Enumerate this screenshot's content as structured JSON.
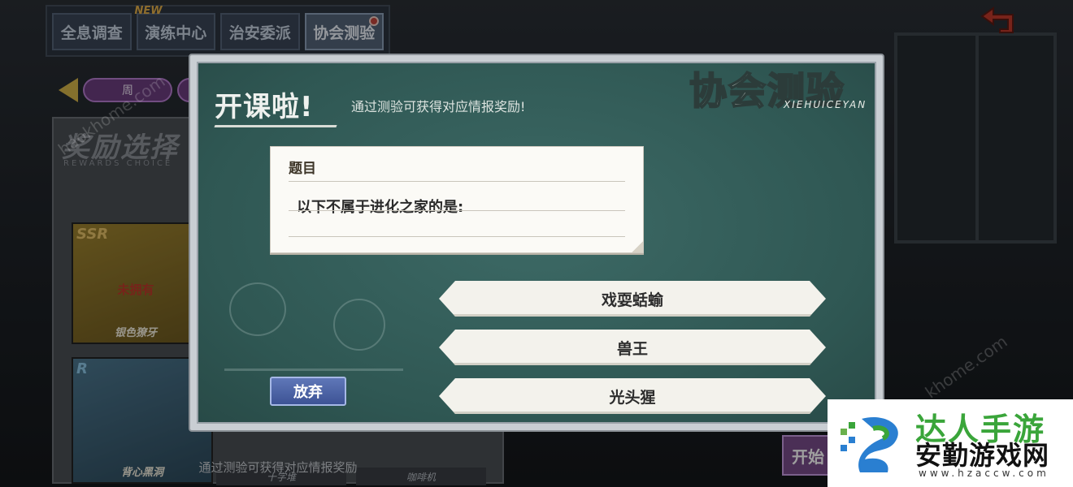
{
  "tabs": [
    {
      "label": "全息调查",
      "active": false
    },
    {
      "label": "演练中心",
      "active": false,
      "badge": "NEW"
    },
    {
      "label": "治安委派",
      "active": false
    },
    {
      "label": "协会测验",
      "active": true
    }
  ],
  "left_panel": {
    "week_label": "周",
    "title": "奖励选择",
    "subtitle": "REWARDS CHOICE",
    "cards": [
      {
        "grade": "SSR",
        "status": "未拥有",
        "name": "银色獠牙"
      },
      {
        "grade": "R",
        "name": "背心黑洞"
      }
    ],
    "mini_names": [
      "十字堆",
      "咖啡机"
    ],
    "footer_hint": "通过测验可获得对应情报奖励"
  },
  "start_button_partial": "开始",
  "quiz": {
    "heading": "开课啦!",
    "subheading": "通过测验可获得对应情报奖励!",
    "logo_plain": "协会",
    "logo_accent": "测验",
    "logo_pinyin": "XIEHUICEYAN",
    "question_label": "题目",
    "question_text": "以下不属于进化之家的是:",
    "answers": [
      "戏耍蛞蝓",
      "兽王",
      "光头猩"
    ],
    "give_up_label": "放弃"
  },
  "watermark": {
    "brand_top": "达人手游",
    "brand_main": "安勤游戏网",
    "brand_url": "www.hzaccw.com",
    "diagonal_texts": [
      "haokhome.com",
      "khome.com"
    ]
  },
  "colors": {
    "board": "#2f5753",
    "accent_logo": "#c7e25b",
    "give_up": "#3d5395",
    "brand_green": "#3aa53a"
  }
}
